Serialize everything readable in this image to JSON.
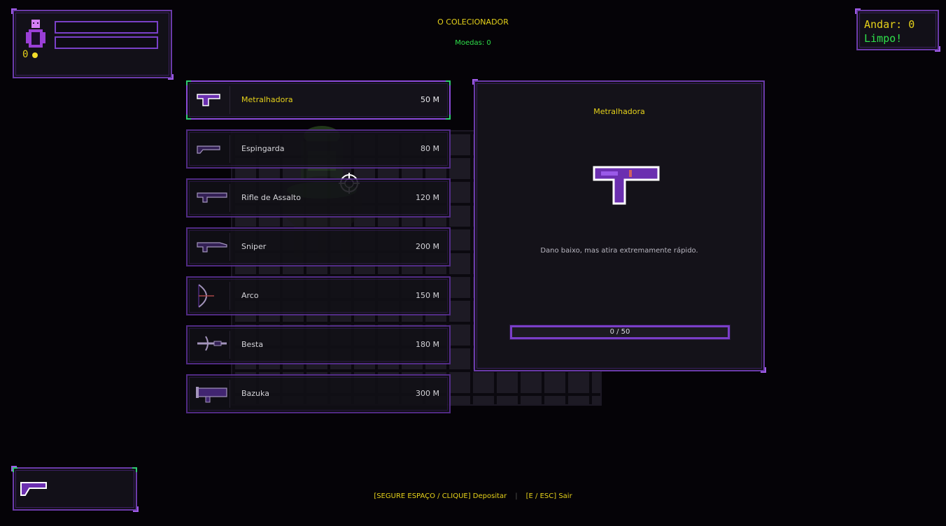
{
  "hud": {
    "coin_count": "0",
    "floor_label": "Andar: 0",
    "status_label": "Limpo!"
  },
  "shop": {
    "title": "O COLECIONADOR",
    "coins_label": "Moedas: 0"
  },
  "items": [
    {
      "name": "Metralhadora",
      "price": "50 M",
      "icon": "smg-icon"
    },
    {
      "name": "Espingarda",
      "price": "80 M",
      "icon": "shotgun-icon"
    },
    {
      "name": "Rifle de Assalto",
      "price": "120 M",
      "icon": "assault-rifle-icon"
    },
    {
      "name": "Sniper",
      "price": "200 M",
      "icon": "sniper-icon"
    },
    {
      "name": "Arco",
      "price": "150 M",
      "icon": "bow-icon"
    },
    {
      "name": "Besta",
      "price": "180 M",
      "icon": "crossbow-icon"
    },
    {
      "name": "Bazuka",
      "price": "300 M",
      "icon": "bazooka-icon"
    }
  ],
  "detail": {
    "name": "Metralhadora",
    "description": "Dano baixo, mas atira extremamente rápido.",
    "progress_text": "0 / 50",
    "progress_fraction": 0
  },
  "footer": {
    "deposit_hint": "[SEGURE ESPAÇO / CLIQUE] Depositar",
    "separator": "|",
    "exit_hint": "[E / ESC] Sair"
  },
  "colors": {
    "accent_purple": "#7a40c8",
    "gold": "#e6d21a",
    "green": "#2ee04a"
  }
}
